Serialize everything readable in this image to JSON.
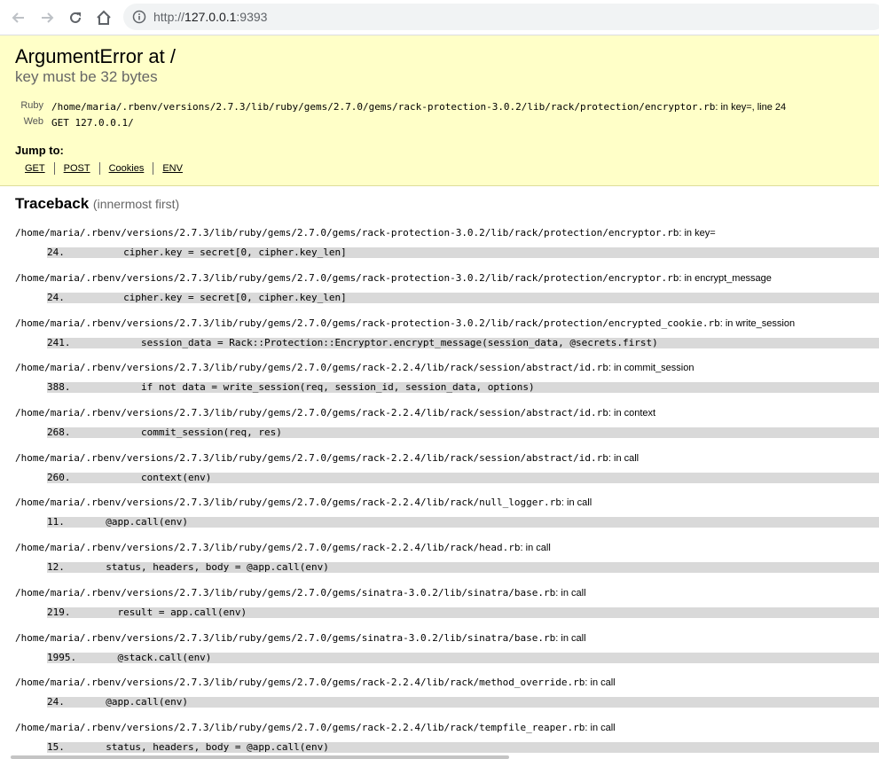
{
  "browser": {
    "url_scheme": "http://",
    "url_host": "127.0.0.1",
    "url_rest": ":9393",
    "icons": [
      "back-arrow-icon",
      "forward-arrow-icon",
      "reload-icon",
      "home-icon",
      "info-icon"
    ]
  },
  "error": {
    "title": "ArgumentError at /",
    "message": "key must be 32 bytes",
    "ruby_label": "Ruby",
    "ruby_path": "/home/maria/.rbenv/versions/2.7.3/lib/ruby/gems/2.7.0/gems/rack-protection-3.0.2/lib/rack/protection/encryptor.rb",
    "ruby_suffix": ": in key=, line 24",
    "web_label": "Web",
    "web_value": "GET 127.0.0.1/"
  },
  "jump": {
    "title": "Jump to:",
    "links": [
      "GET",
      "POST",
      "Cookies",
      "ENV"
    ]
  },
  "traceback": {
    "title": "Traceback",
    "subtitle": "(innermost first)",
    "frames": [
      {
        "path": "/home/maria/.rbenv/versions/2.7.3/lib/ruby/gems/2.7.0/gems/rack-protection-3.0.2/lib/rack/protection/encryptor.rb",
        "fn": ": in key=",
        "code": "24.          cipher.key = secret[0, cipher.key_len]"
      },
      {
        "path": "/home/maria/.rbenv/versions/2.7.3/lib/ruby/gems/2.7.0/gems/rack-protection-3.0.2/lib/rack/protection/encryptor.rb",
        "fn": ": in encrypt_message",
        "code": "24.          cipher.key = secret[0, cipher.key_len]"
      },
      {
        "path": "/home/maria/.rbenv/versions/2.7.3/lib/ruby/gems/2.7.0/gems/rack-protection-3.0.2/lib/rack/protection/encrypted_cookie.rb",
        "fn": ": in write_session",
        "code": "241.            session_data = Rack::Protection::Encryptor.encrypt_message(session_data, @secrets.first)"
      },
      {
        "path": "/home/maria/.rbenv/versions/2.7.3/lib/ruby/gems/2.7.0/gems/rack-2.2.4/lib/rack/session/abstract/id.rb",
        "fn": ": in commit_session",
        "code": "388.            if not data = write_session(req, session_id, session_data, options)"
      },
      {
        "path": "/home/maria/.rbenv/versions/2.7.3/lib/ruby/gems/2.7.0/gems/rack-2.2.4/lib/rack/session/abstract/id.rb",
        "fn": ": in context",
        "code": "268.            commit_session(req, res)"
      },
      {
        "path": "/home/maria/.rbenv/versions/2.7.3/lib/ruby/gems/2.7.0/gems/rack-2.2.4/lib/rack/session/abstract/id.rb",
        "fn": ": in call",
        "code": "260.            context(env)"
      },
      {
        "path": "/home/maria/.rbenv/versions/2.7.3/lib/ruby/gems/2.7.0/gems/rack-2.2.4/lib/rack/null_logger.rb",
        "fn": ": in call",
        "code": "11.       @app.call(env)"
      },
      {
        "path": "/home/maria/.rbenv/versions/2.7.3/lib/ruby/gems/2.7.0/gems/rack-2.2.4/lib/rack/head.rb",
        "fn": ": in call",
        "code": "12.       status, headers, body = @app.call(env)"
      },
      {
        "path": "/home/maria/.rbenv/versions/2.7.3/lib/ruby/gems/2.7.0/gems/sinatra-3.0.2/lib/sinatra/base.rb",
        "fn": ": in call",
        "code": "219.        result = app.call(env)"
      },
      {
        "path": "/home/maria/.rbenv/versions/2.7.3/lib/ruby/gems/2.7.0/gems/sinatra-3.0.2/lib/sinatra/base.rb",
        "fn": ": in call",
        "code": "1995.       @stack.call(env)"
      },
      {
        "path": "/home/maria/.rbenv/versions/2.7.3/lib/ruby/gems/2.7.0/gems/rack-2.2.4/lib/rack/method_override.rb",
        "fn": ": in call",
        "code": "24.       @app.call(env)"
      },
      {
        "path": "/home/maria/.rbenv/versions/2.7.3/lib/ruby/gems/2.7.0/gems/rack-2.2.4/lib/rack/tempfile_reaper.rb",
        "fn": ": in call",
        "code": "15.       status, headers, body = @app.call(env)"
      }
    ]
  }
}
